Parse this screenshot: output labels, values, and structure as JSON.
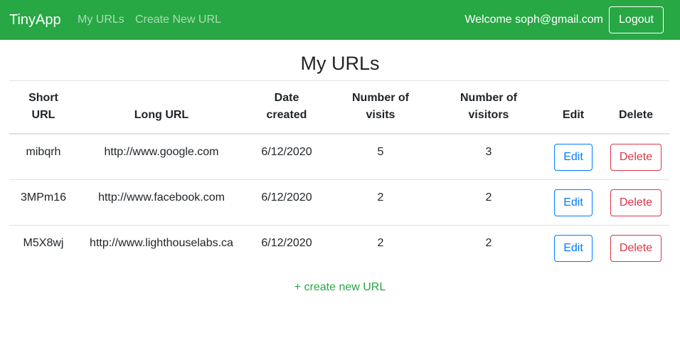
{
  "navbar": {
    "brand": "TinyApp",
    "links": [
      {
        "label": "My URLs"
      },
      {
        "label": "Create New URL"
      }
    ],
    "welcome": "Welcome soph@gmail.com",
    "logout_label": "Logout"
  },
  "main": {
    "title": "My URLs",
    "table": {
      "headers": {
        "short_url": "Short URL",
        "long_url": "Long URL",
        "date_created": "Date created",
        "visits": "Number of visits",
        "visitors": "Number of visitors",
        "edit": "Edit",
        "delete": "Delete"
      },
      "rows": [
        {
          "short_url": "mibqrh",
          "long_url": "http://www.google.com",
          "date_created": "6/12/2020",
          "visits": "5",
          "visitors": "3",
          "edit_label": "Edit",
          "delete_label": "Delete"
        },
        {
          "short_url": "3MPm16",
          "long_url": "http://www.facebook.com",
          "date_created": "6/12/2020",
          "visits": "2",
          "visitors": "2",
          "edit_label": "Edit",
          "delete_label": "Delete"
        },
        {
          "short_url": "M5X8wj",
          "long_url": "http://www.lighthouselabs.ca",
          "date_created": "6/12/2020",
          "visits": "2",
          "visitors": "2",
          "edit_label": "Edit",
          "delete_label": "Delete"
        }
      ]
    },
    "create_link": "+ create new URL"
  },
  "colors": {
    "navbar_bg": "#28a745",
    "edit": "#007bff",
    "delete": "#dc3545",
    "link": "#28a745"
  }
}
